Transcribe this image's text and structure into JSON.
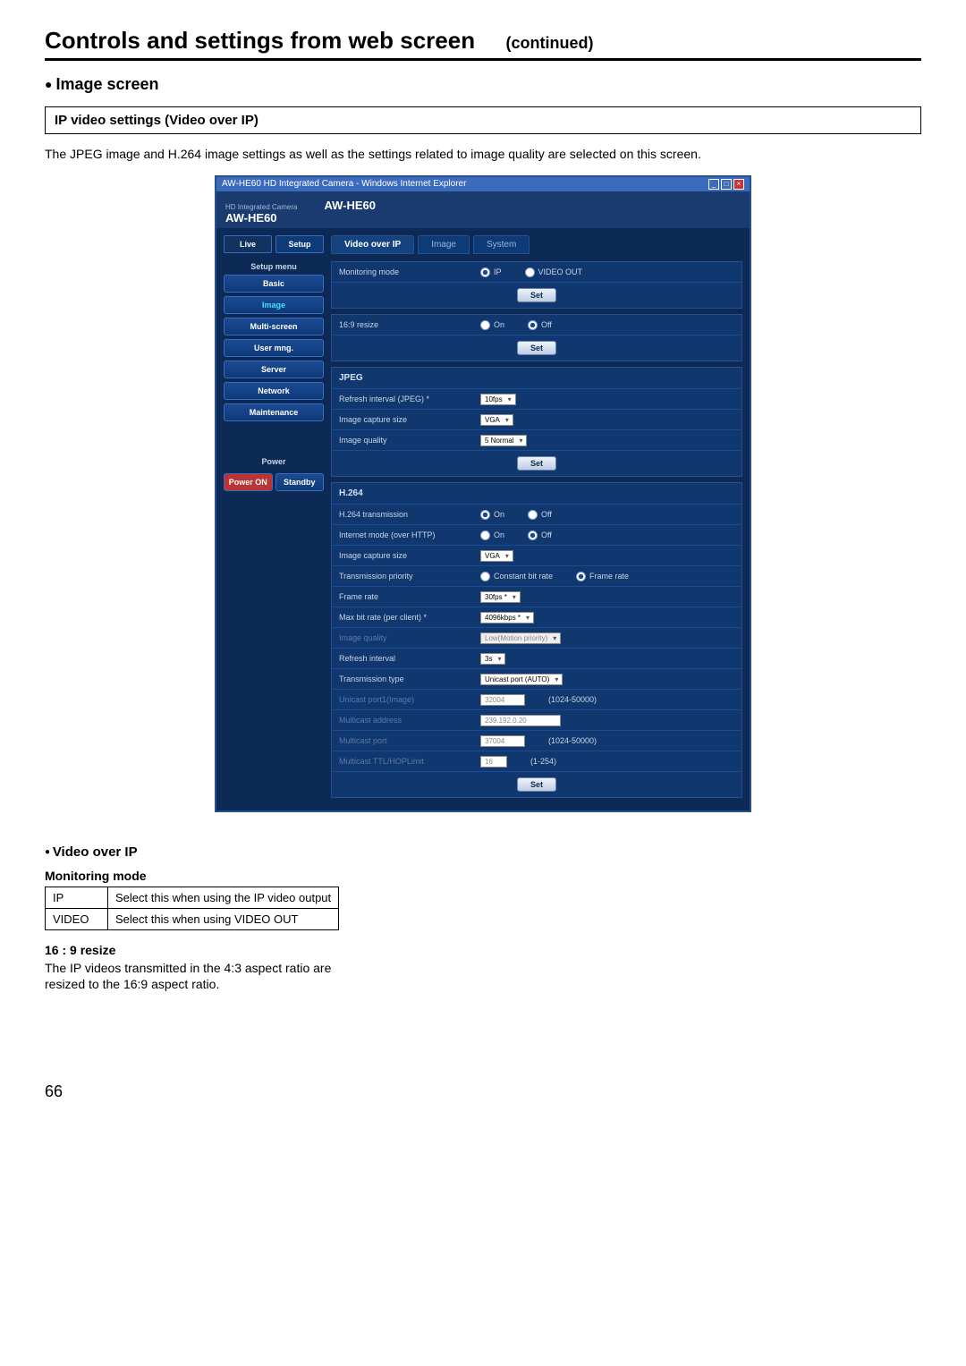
{
  "page": {
    "title": "Controls and settings from web screen",
    "continued": "(continued)",
    "section": "Image screen",
    "subsection": "IP video settings (Video over IP)",
    "intro": "The JPEG image and H.264 image settings as well as the settings related to image quality are selected on this screen.",
    "pageNumber": "66"
  },
  "shot": {
    "windowTitle": "AW-HE60 HD Integrated Camera - Windows Internet Explorer",
    "brandSmall": "HD Integrated Camera",
    "brand": "AW-HE60",
    "headerModel": "AW-HE60",
    "sideTabs": {
      "live": "Live",
      "setup": "Setup"
    },
    "sideMenuLabel": "Setup menu",
    "sideItems": [
      "Basic",
      "Image",
      "Multi-screen",
      "User mng.",
      "Server",
      "Network",
      "Maintenance"
    ],
    "powerLabel": "Power",
    "powerOn": "Power ON",
    "standby": "Standby",
    "mainTabs": {
      "voip": "Video over IP",
      "image": "Image",
      "system": "System"
    },
    "monitoring": {
      "label": "Monitoring mode",
      "opt1": "IP",
      "opt2": "VIDEO OUT",
      "set": "Set"
    },
    "resize": {
      "label": "16:9 resize",
      "opt1": "On",
      "opt2": "Off",
      "set": "Set"
    },
    "jpeg": {
      "header": "JPEG",
      "refresh": "Refresh interval (JPEG) *",
      "refreshVal": "10fps",
      "capsize": "Image capture size",
      "capsizeVal": "VGA",
      "quality": "Image quality",
      "qualityVal": "5 Normal",
      "set": "Set"
    },
    "h264": {
      "header": "H.264",
      "trans": "H.264 transmission",
      "transOn": "On",
      "transOff": "Off",
      "inet": "Internet mode (over HTTP)",
      "inetOn": "On",
      "inetOff": "Off",
      "capsize": "Image capture size",
      "capsizeVal": "VGA",
      "prio": "Transmission priority",
      "prioA": "Constant bit rate",
      "prioB": "Frame rate",
      "frate": "Frame rate",
      "frateVal": "30fps *",
      "maxbit": "Max bit rate (per client) *",
      "maxbitVal": "4096kbps *",
      "iq": "Image quality",
      "iqVal": "Low(Motion priority)",
      "refint": "Refresh interval",
      "refintVal": "3s",
      "ttype": "Transmission type",
      "ttypeVal": "Unicast port (AUTO)",
      "uport": "Unicast port1(Image)",
      "uportVal": "32004",
      "uportRange": "(1024-50000)",
      "maddr": "Multicast address",
      "maddrVal": "239.192.0.20",
      "mport": "Multicast port",
      "mportVal": "37004",
      "mportRange": "(1024-50000)",
      "mttl": "Multicast TTL/HOPLimit",
      "mttlVal": "16",
      "mttlRange": "(1-254)",
      "set": "Set"
    }
  },
  "doc": {
    "voipHeader": "Video over IP",
    "monHeader": "Monitoring mode",
    "row1a": "IP",
    "row1b": "Select this when using the IP video output",
    "row2a": "VIDEO",
    "row2b": "Select this when using VIDEO OUT",
    "resizeHeader": "16 : 9 resize",
    "resizeText1": "The IP videos transmitted in the 4:3 aspect ratio are",
    "resizeText2": "resized to the 16:9 aspect ratio."
  }
}
